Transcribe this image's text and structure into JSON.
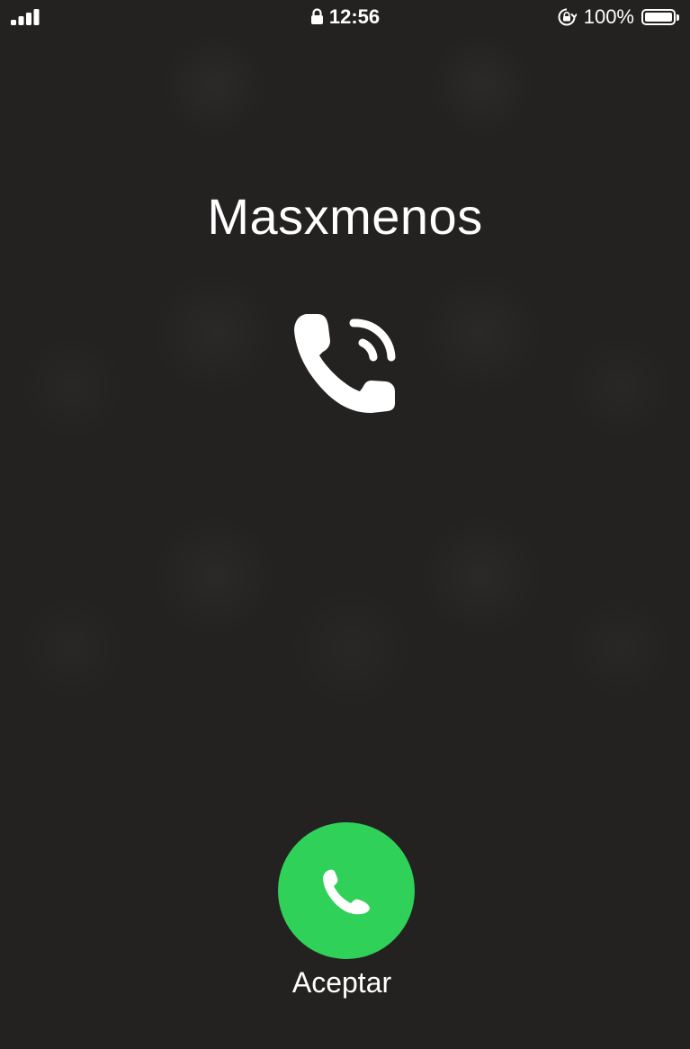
{
  "status_bar": {
    "signal_icon": "cellular-signal-icon",
    "lock_icon": "lock-icon",
    "time": "12:56",
    "rotation_lock_icon": "rotation-lock-icon",
    "battery_percent": "100%",
    "battery_level": 1.0,
    "battery_icon": "battery-icon"
  },
  "call": {
    "caller_name": "Masxmenos",
    "call_type_icon": "whatsapp-voice-call-icon",
    "accept_icon": "phone-icon",
    "accept_label": "Aceptar"
  },
  "colors": {
    "background": "#242221",
    "accept_green": "#30d158",
    "text": "#ffffff"
  }
}
